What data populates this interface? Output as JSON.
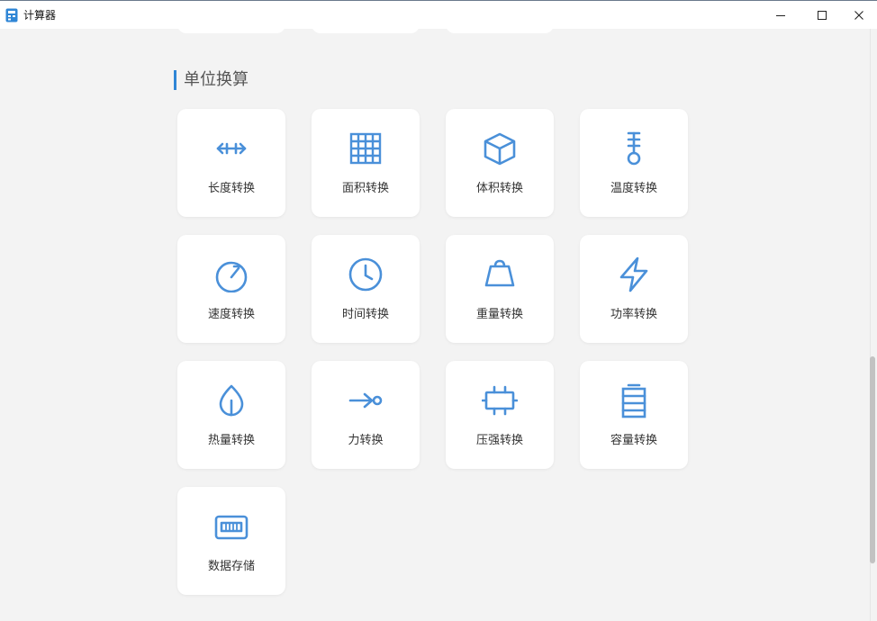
{
  "window": {
    "title": "计算器"
  },
  "section": {
    "title": "单位换算"
  },
  "cards": [
    {
      "label": "长度转换",
      "icon": "arrows-horizontal-icon"
    },
    {
      "label": "面积转换",
      "icon": "grid-icon"
    },
    {
      "label": "体积转换",
      "icon": "cube-icon"
    },
    {
      "label": "温度转换",
      "icon": "thermometer-icon"
    },
    {
      "label": "速度转换",
      "icon": "speedometer-icon"
    },
    {
      "label": "时间转换",
      "icon": "clock-icon"
    },
    {
      "label": "重量转换",
      "icon": "weight-icon"
    },
    {
      "label": "功率转换",
      "icon": "lightning-icon"
    },
    {
      "label": "热量转换",
      "icon": "drop-icon"
    },
    {
      "label": "力转换",
      "icon": "force-arrow-icon"
    },
    {
      "label": "压强转换",
      "icon": "pressure-icon"
    },
    {
      "label": "容量转换",
      "icon": "battery-icon"
    },
    {
      "label": "数据存储",
      "icon": "storage-icon"
    }
  ],
  "colors": {
    "accent": "#2f86d6",
    "icon": "#4a90d9",
    "background": "#f3f3f3",
    "card": "#ffffff"
  }
}
